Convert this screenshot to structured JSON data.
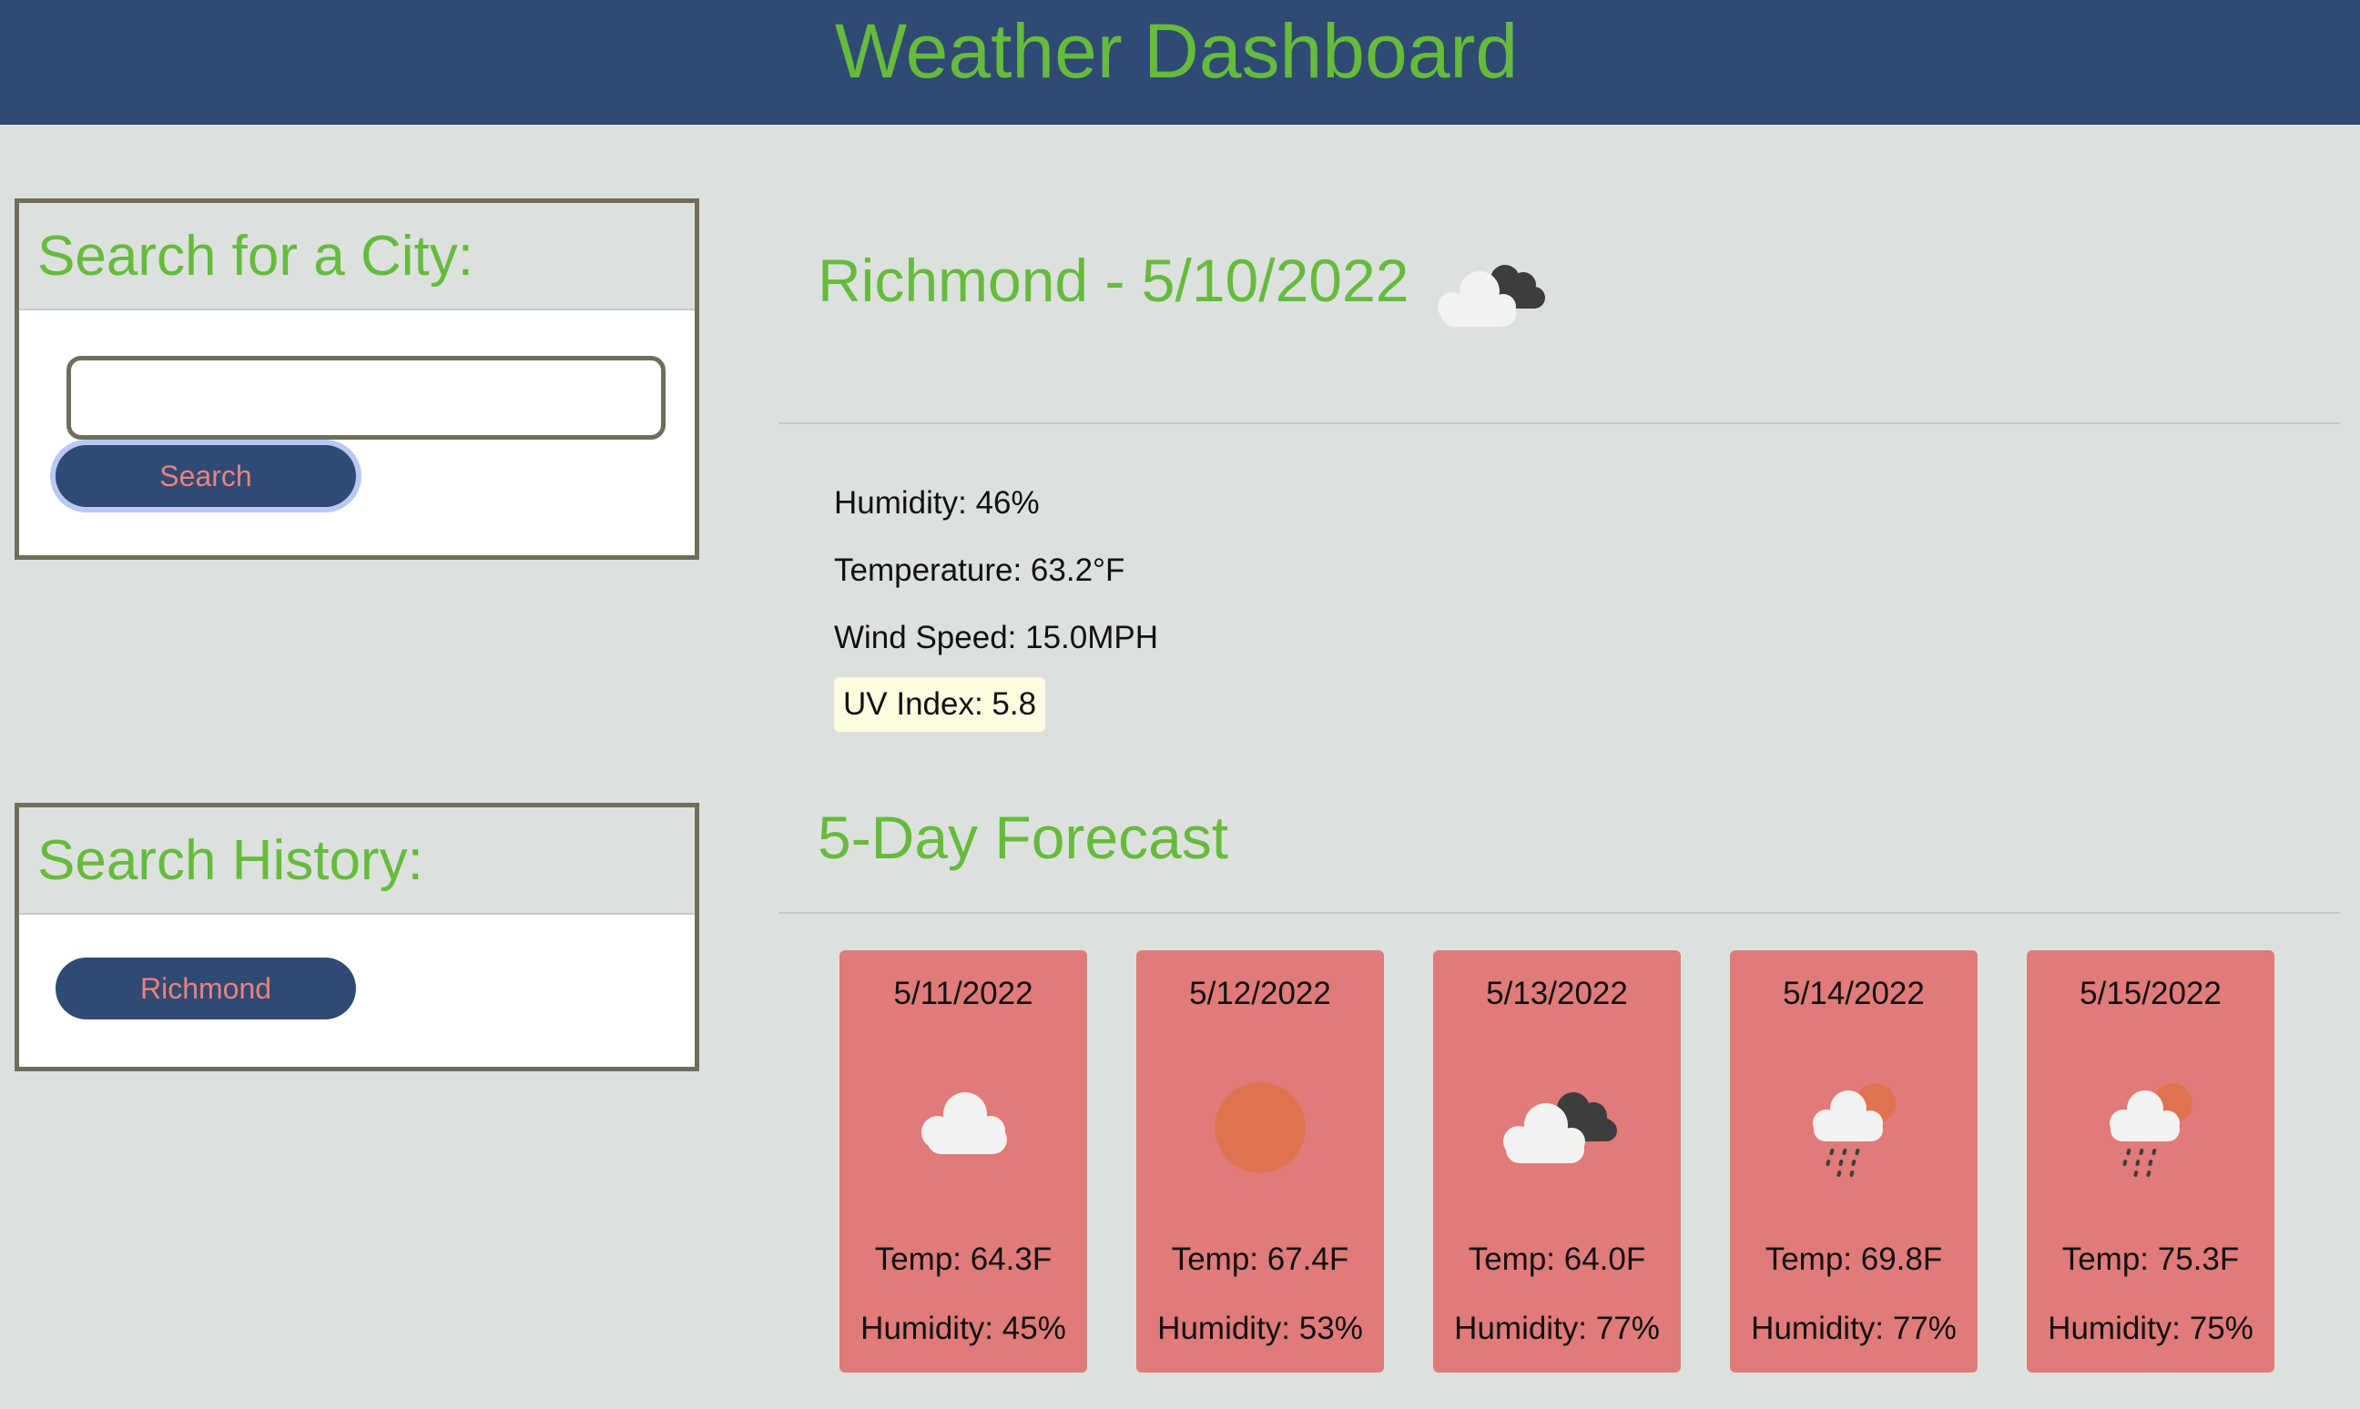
{
  "header": {
    "title": "Weather Dashboard",
    "bg_color": "#2f4a73",
    "title_color": "#66bb3d"
  },
  "search": {
    "heading": "Search for a City:",
    "input_value": "",
    "button_label": "Search"
  },
  "history": {
    "heading": "Search History:",
    "items": [
      "Richmond"
    ]
  },
  "current": {
    "title": "Richmond - 5/10/2022",
    "icon": "broken-clouds-icon",
    "humidity": "Humidity: 46%",
    "temperature": "Temperature: 63.2°F",
    "wind": "Wind Speed: 15.0MPH",
    "uv": "UV Index: 5.8"
  },
  "forecast": {
    "heading": "5-Day Forecast",
    "card_color": "#e07b79",
    "days": [
      {
        "date": "5/11/2022",
        "icon": "cloud-icon",
        "temp": "Temp: 64.3F",
        "humidity": "Humidity: 45%"
      },
      {
        "date": "5/12/2022",
        "icon": "sun-icon",
        "temp": "Temp: 67.4F",
        "humidity": "Humidity: 53%"
      },
      {
        "date": "5/13/2022",
        "icon": "broken-clouds-icon",
        "temp": "Temp: 64.0F",
        "humidity": "Humidity: 77%"
      },
      {
        "date": "5/14/2022",
        "icon": "rain-sun-icon",
        "temp": "Temp: 69.8F",
        "humidity": "Humidity: 77%"
      },
      {
        "date": "5/15/2022",
        "icon": "rain-sun-icon",
        "temp": "Temp: 75.3F",
        "humidity": "Humidity: 75%"
      }
    ]
  }
}
